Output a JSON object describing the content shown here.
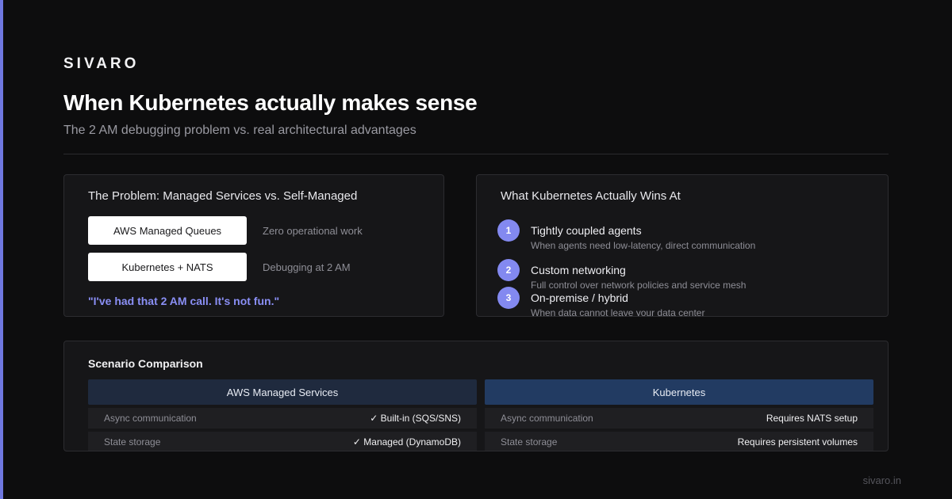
{
  "brand": "SIVARO",
  "title": "When Kubernetes actually makes sense",
  "subtitle": "The 2 AM debugging problem vs. real architectural advantages",
  "problem": {
    "title": "The Problem: Managed Services vs. Self-Managed",
    "options": [
      {
        "label": "AWS Managed Queues",
        "note": "Zero operational work"
      },
      {
        "label": "Kubernetes + NATS",
        "note": "Debugging at 2 AM"
      }
    ],
    "quote": "\"I've had that 2 AM call. It's not fun.\""
  },
  "wins": {
    "title": "What Kubernetes Actually Wins At",
    "items": [
      {
        "num": "1",
        "title": "Tightly coupled agents",
        "desc": "When agents need low-latency, direct communication"
      },
      {
        "num": "2",
        "title": "Custom networking",
        "desc": "Full control over network policies and service mesh"
      },
      {
        "num": "3",
        "title": "On-premise / hybrid",
        "desc": "When data cannot leave your data center"
      }
    ]
  },
  "comparison": {
    "title": "Scenario Comparison",
    "columns": [
      {
        "header": "AWS Managed Services",
        "rows": [
          {
            "label": "Async communication",
            "value": "✓ Built-in (SQS/SNS)"
          },
          {
            "label": "State storage",
            "value": "✓ Managed (DynamoDB)"
          }
        ]
      },
      {
        "header": "Kubernetes",
        "rows": [
          {
            "label": "Async communication",
            "value": "Requires NATS setup"
          },
          {
            "label": "State storage",
            "value": "Requires persistent volumes"
          }
        ]
      }
    ]
  },
  "footer": "sivaro.in",
  "colors": {
    "accent": "#6f78e0",
    "quote": "#8a8ff5",
    "badge": "#8389f0",
    "aws_header": "#1f2a3e",
    "k8s_header": "#223b62"
  }
}
